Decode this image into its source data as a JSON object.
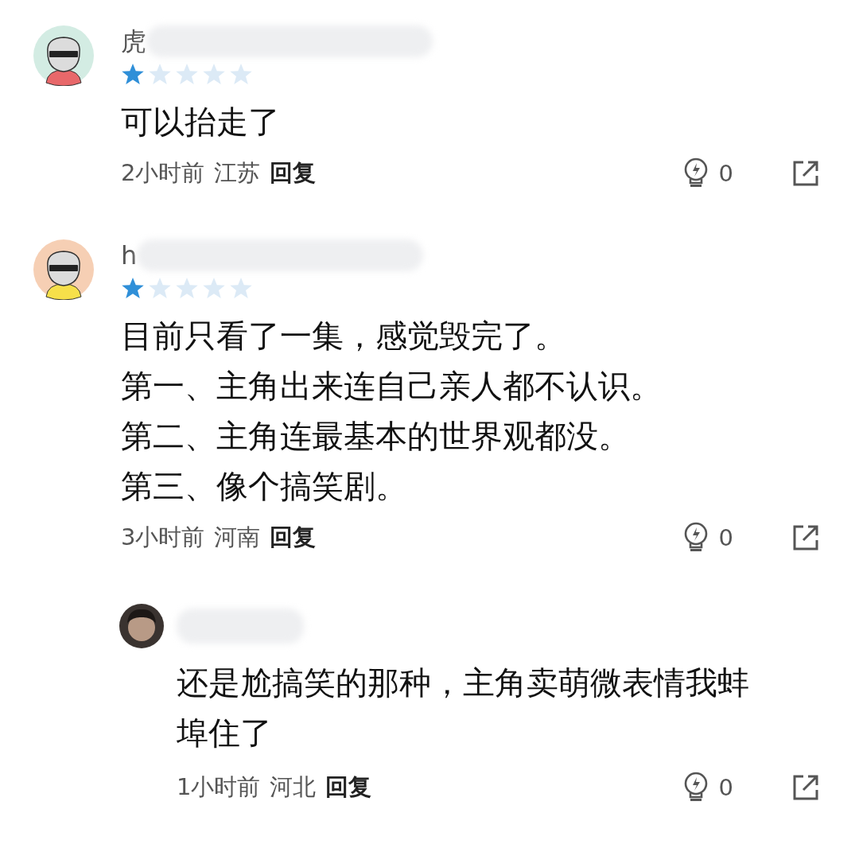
{
  "comments": [
    {
      "avatar": {
        "kind": "cartoon",
        "color": "#d3ece3",
        "shirt": {
          "color": "#e8686a"
        }
      },
      "name": "虎",
      "stars": 1,
      "lines": [
        "可以抬走了"
      ],
      "time": "2小时前",
      "location": "江苏",
      "reply_label": "回复",
      "likes": "0"
    },
    {
      "avatar": {
        "kind": "cartoon",
        "color": "#f6cfb4",
        "shirt": {
          "color": "#f7e04a"
        }
      },
      "name": "h",
      "stars": 1,
      "lines": [
        "目前只看了一集，感觉毁完了。",
        "第一、主角出来连自己亲人都不认识。",
        "第二、主角连最基本的世界观都没。",
        "第三、像个搞笑剧。"
      ],
      "time": "3小时前",
      "location": "河南",
      "reply_label": "回复",
      "likes": "0",
      "replies": [
        {
          "avatar": {
            "kind": "photo"
          },
          "lines": [
            "还是尬搞笑的那种，主角卖萌微表情我蚌埠住了"
          ],
          "time": "1小时前",
          "location": "河北",
          "reply_label": "回复",
          "likes": "0"
        }
      ]
    }
  ]
}
